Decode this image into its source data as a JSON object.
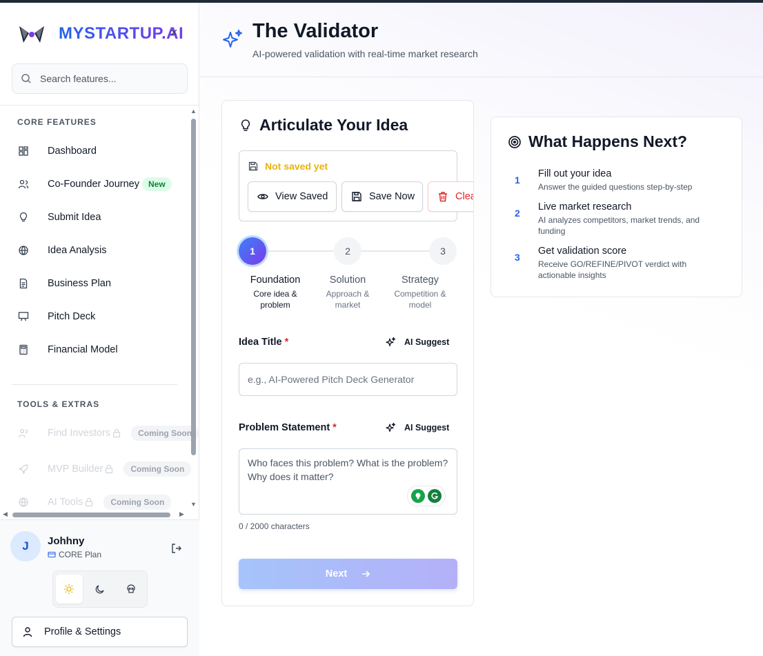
{
  "brand": {
    "name": "MYSTARTUP.AI",
    "close_glyph": "×"
  },
  "search": {
    "placeholder": "Search features..."
  },
  "sidebar": {
    "core_label": "CORE FEATURES",
    "core_items": [
      {
        "label": "Dashboard",
        "icon": "dashboard-icon"
      },
      {
        "label": "Co-Founder Journey",
        "icon": "users-icon",
        "badge": "New"
      },
      {
        "label": "Submit Idea",
        "icon": "lightbulb-icon"
      },
      {
        "label": "Idea Analysis",
        "icon": "globe-icon"
      },
      {
        "label": "Business Plan",
        "icon": "document-icon"
      },
      {
        "label": "Pitch Deck",
        "icon": "presentation-icon"
      },
      {
        "label": "Financial Model",
        "icon": "calculator-icon"
      }
    ],
    "tools_label": "TOOLS & EXTRAS",
    "tools_items": [
      {
        "label": "Find Investors",
        "icon": "users-icon",
        "badge": "Coming Soon"
      },
      {
        "label": "MVP Builder",
        "icon": "rocket-icon",
        "badge": "Coming Soon"
      },
      {
        "label": "AI Tools",
        "icon": "globe-icon",
        "badge": "Coming Soon"
      }
    ]
  },
  "user": {
    "initial": "J",
    "name": "Johhny",
    "plan": "CORE Plan"
  },
  "profile": {
    "label": "Profile & Settings"
  },
  "header": {
    "title": "The Validator",
    "subtitle": "AI-powered validation with real-time market research"
  },
  "idea_card": {
    "title": "Articulate Your Idea",
    "save_status": "Not saved yet",
    "buttons": {
      "view_saved": "View Saved",
      "save_now": "Save Now",
      "clear_draft": "Clear Draft"
    },
    "steps": [
      {
        "num": "1",
        "name": "Foundation",
        "desc1": "Core idea &",
        "desc2": "problem"
      },
      {
        "num": "2",
        "name": "Solution",
        "desc1": "Approach &",
        "desc2": "market"
      },
      {
        "num": "3",
        "name": "Strategy",
        "desc1": "Competition &",
        "desc2": "model"
      }
    ],
    "idea_title": {
      "label": "Idea Title",
      "required": "*",
      "ai": "AI Suggest",
      "placeholder": "e.g., AI-Powered Pitch Deck Generator",
      "value": ""
    },
    "problem": {
      "label": "Problem Statement",
      "required": "*",
      "ai": "AI Suggest",
      "placeholder": "Who faces this problem? What is the problem? Why does it matter?",
      "value": ""
    },
    "char_count": "0 / 2000 characters",
    "next": "Next"
  },
  "next_card": {
    "title": "What Happens Next?",
    "items": [
      {
        "num": "1",
        "title": "Fill out your idea",
        "text": "Answer the guided questions step-by-step"
      },
      {
        "num": "2",
        "title": "Live market research",
        "text": "AI analyzes competitors, market trends, and funding"
      },
      {
        "num": "3",
        "title": "Get validation score",
        "text": "Receive GO/REFINE/PIVOT verdict with actionable insights"
      }
    ]
  },
  "colors": {
    "accent": "#2563eb",
    "brand_gradient_end": "#7c3aed",
    "warning": "#eab308",
    "danger": "#dc2626",
    "success_badge": "#15803d"
  }
}
